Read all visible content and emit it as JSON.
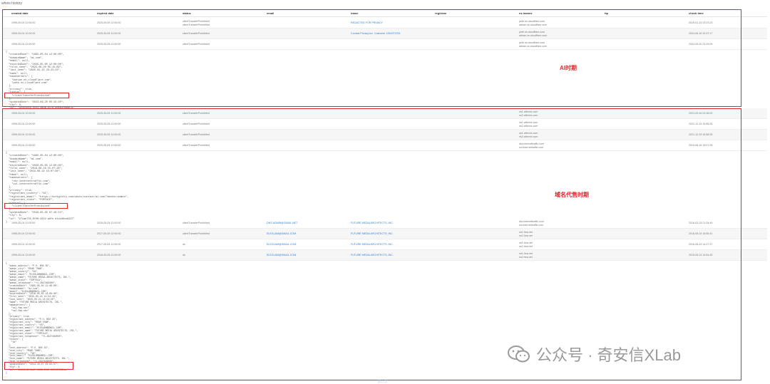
{
  "page": {
    "title": "whois history",
    "footer": "第1/1页"
  },
  "columns": [
    "created date",
    "expired date",
    "status",
    "email",
    "name",
    "registrar",
    "ns names",
    "ttp",
    "check time"
  ],
  "section1": {
    "annotation": "AI时期",
    "rows": [
      {
        "created": "1995-05-04 12:00:00",
        "expired": "2025-05-05 12:00:00",
        "status": [
          "clientTransferProhibited"
        ],
        "email": "",
        "name": "REDACTED FOR PRIVACY",
        "ns": [
          "pete.ns.cloudflare.com",
          "adrian.ns.cloudflare.com"
        ],
        "check": "2025-01-15 23:23:23"
      },
      {
        "created": "1995-05-04 12:00:00",
        "expired": "2025-05-05 12:00:00",
        "status": [
          "clientTransferProhibited"
        ],
        "email": "",
        "name": "Contact Privacy Inc. Customer 1261571251",
        "ns": [
          "pete.ns.cloudflare.com",
          "adrian.ns.cloudflare.com"
        ],
        "check": "2024-06-16 20:37:17"
      },
      {
        "created": "1995-05-04 12:00:00",
        "expired": "2025-05-05 12:00:00",
        "status": [
          "clientTransferProhibited"
        ],
        "email": "",
        "name": "",
        "ns": [
          "pete.ns.cloudflare.com",
          "adrian.ns.cloudflare.com"
        ],
        "check": "2024-09-20 23:15:09"
      }
    ],
    "json": "{\n  \"createdDate\": \"1995-05-04 12:00:00\",\n  \"domainName\": \"ai.com\",\n  \"email\": null,\n  \"expiredDate\": \"2025-05-05 12:00:00\",\n  \"first_seen\": \"2023-09-20 05:15:09\",\n  \"last_seen\": \"2025-01-15 23:23:23\",\n  \"name\": null,\n  \"nameservers\": [\n    \"adrian.ns.cloudflare.com\",\n    \"pete.ns.cloudflare.com\"\n  ],\n  \"privacy\": true,\n  \"status\": [\n    \"clientTransferProhibited\"\n  ],\n  \"updatedDate\": \"2023-09-20 05:15:20\",\n  \"ttp\": 0,\n  \"id\": \"3c451616-xxx1-4a3a-917d-80ea4f8dad78\"\n}"
  },
  "section2": {
    "annotation": "域名代售时期",
    "rows": [
      {
        "created": "1995-05-04 12:00:00",
        "expired": "2025-05-05 12:00:00",
        "status": [
          "clientTransferProhibited"
        ],
        "email": "",
        "name": "",
        "ns": [
          "ns1.afternic.com",
          "ns2.afternic.com"
        ],
        "check": "2021-09-16 02:38:00"
      },
      {
        "created": "1995-05-04 12:00:00",
        "expired": "2025-05-05 12:00:00",
        "status": [
          "clientTransferProhibited"
        ],
        "email": "",
        "name": "",
        "ns": [
          "ns1.afternic.com",
          "ns2.afternic.com"
        ],
        "check": "2021-12-29 15:56:25"
      },
      {
        "created": "1995-05-04 12:00:00",
        "expired": "2025-05-05 12:00:00",
        "status": [
          "clientTransferProhibited"
        ],
        "email": "",
        "name": "",
        "ns": [
          "ns1.afternic.com",
          "ns2.afternic.com"
        ],
        "check": "2021-12-29 15:56:25"
      },
      {
        "created": "1995-05-04 12:00:00",
        "expired": "2025-05-05 12:00:00",
        "status": [
          "clientTransferProhibited"
        ],
        "email": "",
        "name": "",
        "ns": [
          "dsv.internettraffic.com",
          "sul.internettraffic.com"
        ],
        "check": "2019-08-18 15:07:28"
      }
    ],
    "json": "{\n  \"createdDate\": \"1995-05-04 12:00:00\",\n  \"domainName\": \"ai.com\",\n  \"email\": null,\n  \"expiredDate\": \"2020-05-05 12:00:00\",\n  \"first_seen\": \"2019-08-18 15:07:28\",\n  \"last_seen\": \"2019-08-18 15:07:28\",\n  \"name\": null,\n  \"nameservers\": [\n    \"dsv.internettraffic.com\",\n    \"sul.internettraffic.com\"\n  ],\n  \"privacy\": true,\n  \"registrant_country\": \"AI\",\n  \"registrant_email\": \"https://ncregistry.com/whois/contact/ai.com/?anchor=admin\",\n  \"registrant_state\": \"FORTALE\",\n  \"status\": [\n    \"clientTransferProhibited\"\n  ],\n  \"updatedDate\": \"2019-05-05 07:18:14\",\n  \"ttp\": 0,\n  \"id\": \"27cae735-0f00-4022-a0fe-61dc80ce9327\"\n}"
  },
  "section3": {
    "rows": [
      {
        "created": "1995-05-04 12:00:00",
        "expired": "2018-05-05 12:00:00",
        "status": [
          "clientTransferProhibited"
        ],
        "email": "DNS.ADMIN@GMAIL.NET",
        "name": "FUTURE MEDIA ARCHITECTS, INC.",
        "ns": [
          "dsv.internettraffic.com",
          "sul.internettraffic.com"
        ],
        "check": "2018-03-24 21:34:49"
      },
      {
        "created": "1995-05-04 12:00:00",
        "expired": "2017-05-05 12:00:00",
        "status": [
          "clientTransferProhibited"
        ],
        "email": "ELEGLAM@GMAIL.COM",
        "name": "FUTURE MEDIA ARCHITECTS, INC.",
        "ns": [
          "ns1.fma.net",
          "ns2.fma.net"
        ],
        "check": "2016-05-24 18:55:41"
      },
      {
        "created": "1995-05-04 12:00:00",
        "expired": "2017-05-05 12:00:00",
        "status": [
          "ok"
        ],
        "email": "ELEGLAM@GMAIL.COM",
        "name": "FUTURE MEDIA ARCHITECTS, INC.",
        "ns": [
          "ns1.fma.net",
          "ns2.fma.net"
        ],
        "check": "2016-05-24 14:27:37"
      },
      {
        "created": "1995-05-04 12:00:00",
        "expired": "2016-05-05 12:00:00",
        "status": [
          "ok"
        ],
        "email": "ELEGLAM@GMAIL.COM",
        "name": "FUTURE MEDIA ARCHITECTS, INC.",
        "ns": [
          "ns1.fma.net",
          "ns2.fma.net"
        ],
        "check": "2015-05-24 14:54:45"
      }
    ],
    "json": "{\n  \"admin_address\": \"P.O. BOX 35\",\n  \"admin_city\": \"ROAD TOWN\",\n  \"admin_country\": \"VG\",\n  \"admin_email\": \"ELEGLAM@GMAIL.COM\",\n  \"admin_name\": \"FUTURE MEDIA ARCHITECTS, INC.\",\n  \"admin_state\": \"TORTOLA\",\n  \"admin_telephone\": \"+1.2847499000\",\n  \"createdDate\": \"1995-05-04 12:00:00\",\n  \"domainName\": \"ai.com\",\n  \"email\": \"ELEGLAM@GMAIL.COM\",\n  \"expiredDate\": \"2016-05-05 12:00:00\",\n  \"first_seen\": \"2015-05-24 14:54:45\",\n  \"last_seen\": \"2015-05-24 14:54:45\",\n  \"name\": \"FUTURE MEDIA ARCHITECTS, INC.\",\n  \"nameservers\": [\n    \"ns1.fma.net\",\n    \"ns2.fma.net\"\n  ],\n  \"privacy\": true,\n  \"registrant_address\": \"P.O. BOX 35\",\n  \"registrant_city\": \"ROAD TOWN\",\n  \"registrant_country\": \"VG\",\n  \"registrant_email\": \"ELEGLAM@GMAIL.COM\",\n  \"registrant_name\": \"FUTURE MEDIA ARCHITECTS, INC.\",\n  \"registrant_state\": \"TORTOLA\",\n  \"registrant_telephone\": \"+1.2847499000\",\n  \"status\": [\n    \"ok\"\n  ],\n  \"tech_address\": \"P.O. BOX 35\",\n  \"tech_city\": \"ROAD TOWN\",\n  \"tech_country\": \"VG\",\n  \"tech_email\": \"ELEGLAM@GMAIL.COM\",\n  \"tech_name\": \"FUTURE MEDIA ARCHITECTS, INC.\",\n  \"tech_telephone\": \"+1.2847499000\",\n  \"updatedDate\": \"2014-10-07 04:55:57\",\n  \"ttp\": 0,\n  \"id\": \"0b6b3c66-6a6f-4468-8512-3221305292ae\"\n}"
  },
  "watermark": {
    "text": "公众号 · 奇安信XLab"
  }
}
